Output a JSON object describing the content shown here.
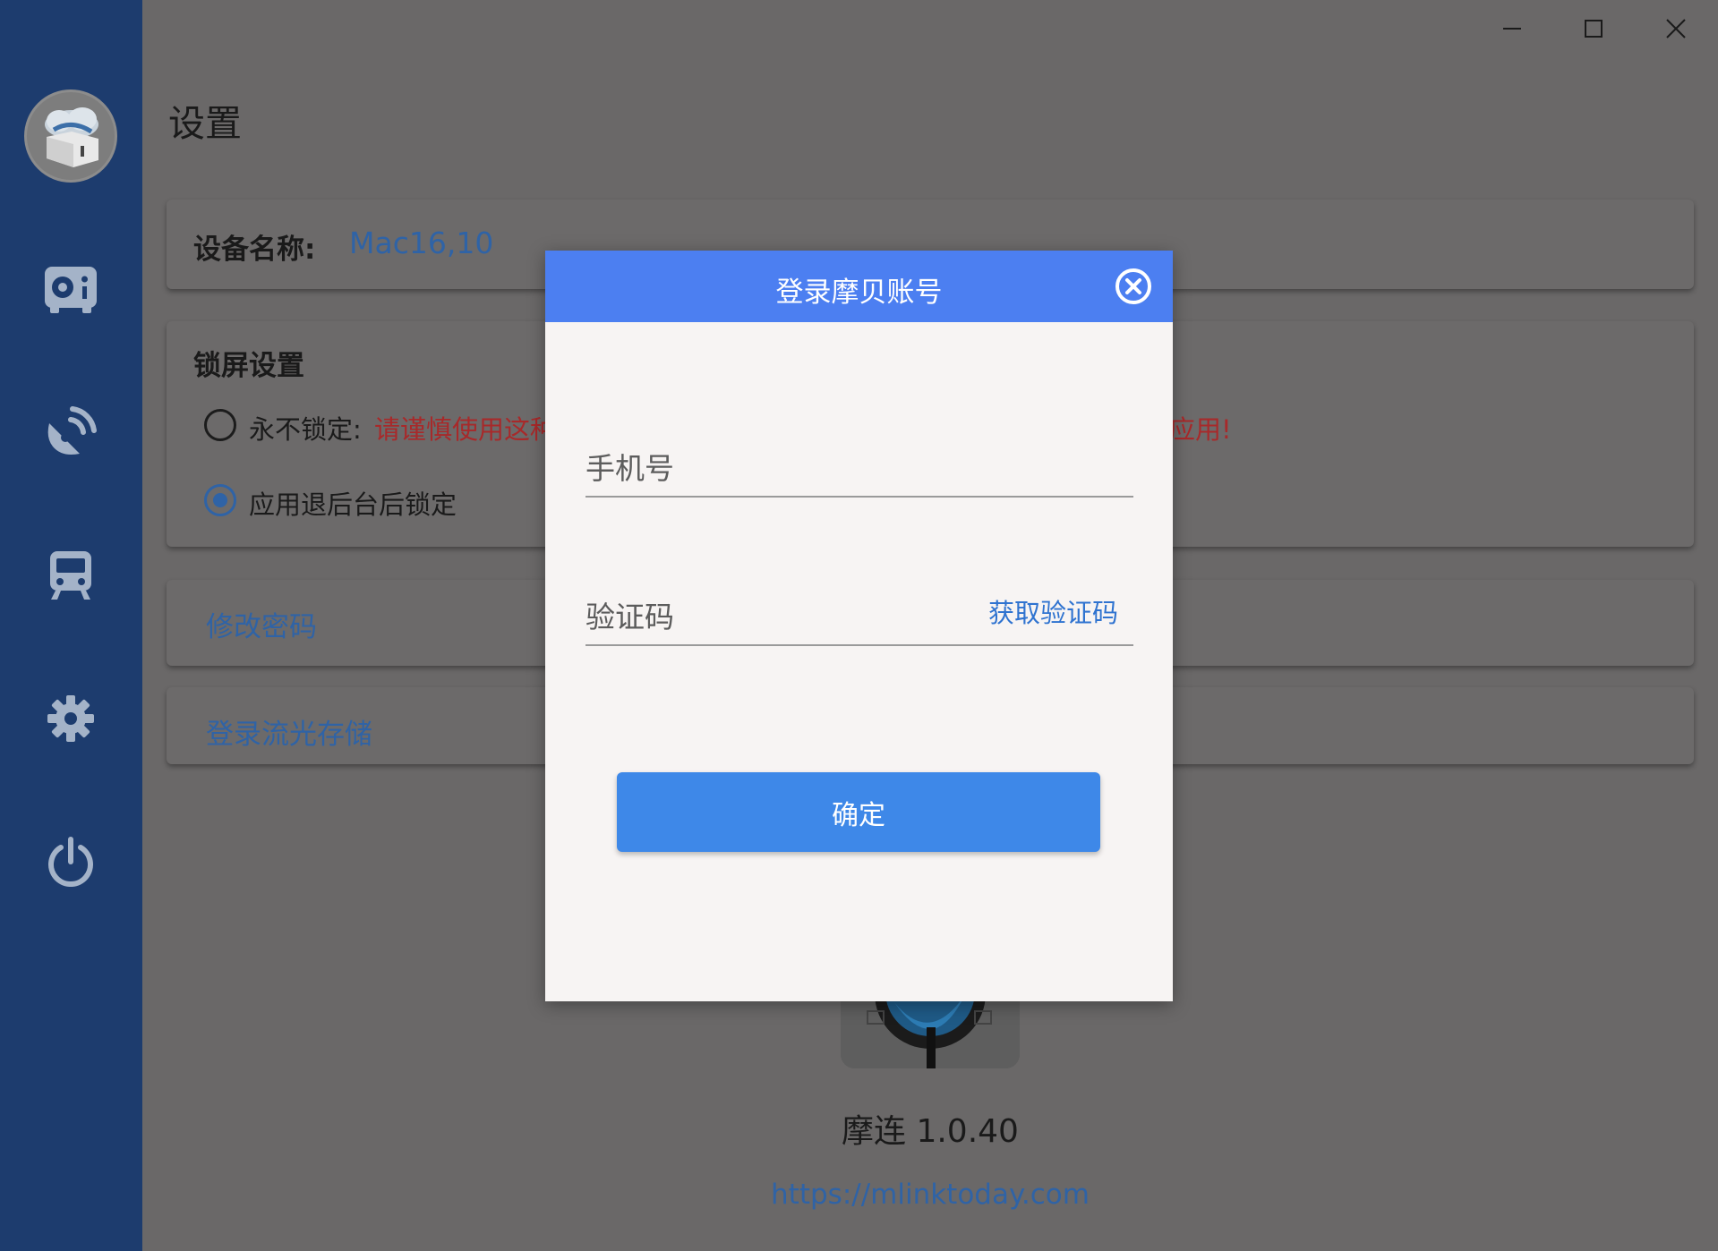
{
  "window": {
    "minimize_icon": "minimize-icon",
    "maximize_icon": "maximize-icon",
    "close_icon": "close-icon"
  },
  "sidebar": {
    "items": [
      {
        "icon": "disk-icon"
      },
      {
        "icon": "satellite-icon"
      },
      {
        "icon": "train-icon"
      },
      {
        "icon": "gear-icon"
      },
      {
        "icon": "power-icon"
      }
    ]
  },
  "page": {
    "title": "设置",
    "device": {
      "label": "设备名称:",
      "value": "Mac16,10"
    },
    "lock": {
      "title": "锁屏设置",
      "option_never_label": "永不锁定:",
      "option_never_warning_left": "请谨慎使用这种",
      "option_never_warning_right": "应用!",
      "option_background_label": "应用退后台后锁定",
      "selected": "background"
    },
    "change_password": "修改密码",
    "login_storage": "登录流光存储",
    "version": "摩连 1.0.40",
    "url": "https://mlinktoday.com"
  },
  "dialog": {
    "title": "登录摩贝账号",
    "phone_placeholder": "手机号",
    "code_placeholder": "验证码",
    "get_code": "获取验证码",
    "confirm": "确定"
  },
  "colors": {
    "sidebar": "#1d3c6e",
    "dialog_header": "#4c7ff1",
    "confirm_button": "#3e88e8",
    "link": "#2f63a6",
    "warning": "#a8292a"
  }
}
